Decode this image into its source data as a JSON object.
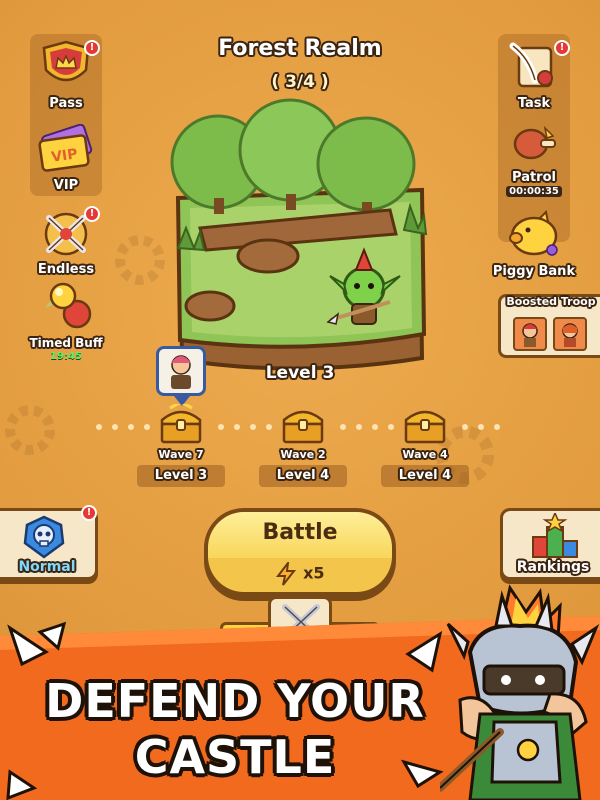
{
  "realm": {
    "title": "Forest Realm",
    "progress": "( 3/4 )"
  },
  "left_menu": [
    {
      "label": "Pass",
      "icon": "crown-shield-icon",
      "badge": "!"
    },
    {
      "label": "VIP",
      "icon": "vip-ticket-icon"
    },
    {
      "label": "Endless",
      "icon": "endless-swords-icon",
      "badge": "!"
    },
    {
      "label": "Timed Buff",
      "timer": "19:45",
      "icon": "potion-icon"
    }
  ],
  "right_menu": [
    {
      "label": "Task",
      "icon": "scroll-quill-icon",
      "badge": "!"
    },
    {
      "label": "Patrol",
      "timer": "00:00:35",
      "icon": "patrol-meat-icon"
    },
    {
      "label": "Piggy Bank",
      "icon": "piggy-bank-icon"
    },
    {
      "label": "Boosted Troop",
      "icon": "boosted-troop-icon"
    }
  ],
  "stage": {
    "current_level": "Level 3"
  },
  "waves": [
    {
      "wave": "Wave 7",
      "level": "Level 3"
    },
    {
      "wave": "Wave 2",
      "level": "Level 4"
    },
    {
      "wave": "Wave 4",
      "level": "Level 4"
    }
  ],
  "battle": {
    "label": "Battle",
    "cost": "x5",
    "cost_icon": "lightning-icon"
  },
  "mode_button": {
    "label": "Normal",
    "icon": "skull-icon",
    "badge": "!"
  },
  "rankings_button": {
    "label": "Rankings",
    "icon": "podium-star-icon"
  },
  "bottom_tabs": {
    "badge": "!",
    "icon": "crossed-swords-icon"
  },
  "promo": {
    "line1": "DEFEND YOUR",
    "line2": "CASTLE"
  },
  "colors": {
    "background": "#e9a447",
    "banner": "#f26a1e",
    "badge": "#e53935",
    "battle": "#f7d65a"
  }
}
